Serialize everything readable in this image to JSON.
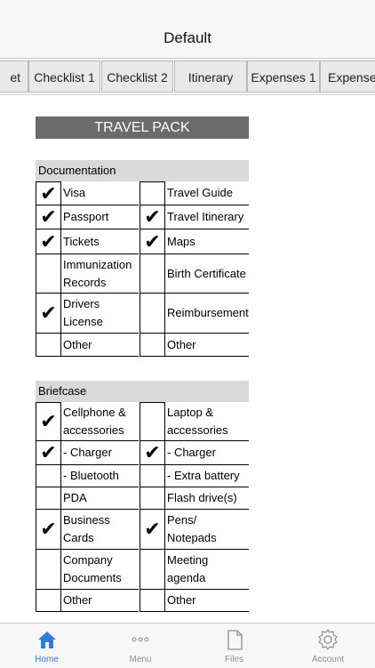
{
  "nav": {
    "title": "Default"
  },
  "tabs": [
    {
      "label": "et"
    },
    {
      "label": "Checklist 1"
    },
    {
      "label": "Checklist 2"
    },
    {
      "label": "Itinerary"
    },
    {
      "label": "Expenses 1"
    },
    {
      "label": "Expense"
    }
  ],
  "pack_title": "TRAVEL PACK",
  "sections": [
    {
      "title": "Documentation",
      "rows": [
        {
          "left": {
            "label": "Visa",
            "checked": true
          },
          "right": {
            "label": "Travel Guide",
            "checked": false
          }
        },
        {
          "left": {
            "label": "Passport",
            "checked": true
          },
          "right": {
            "label": "Travel Itinerary",
            "checked": true
          }
        },
        {
          "left": {
            "label": "Tickets",
            "checked": true
          },
          "right": {
            "label": "Maps",
            "checked": true
          }
        },
        {
          "left": {
            "label": "Immunization Records",
            "checked": false
          },
          "right": {
            "label": "Birth Certificate",
            "checked": false
          }
        },
        {
          "left": {
            "label": "Drivers License",
            "checked": true
          },
          "right": {
            "label": "Reimbursement",
            "checked": false
          }
        },
        {
          "left": {
            "label": "Other",
            "checked": false
          },
          "right": {
            "label": "Other",
            "checked": false
          }
        }
      ]
    },
    {
      "title": "Briefcase",
      "rows": [
        {
          "left": {
            "label": "Cellphone & accessories",
            "checked": true
          },
          "right": {
            "label": "Laptop & accessories",
            "checked": false
          }
        },
        {
          "left": {
            "label": "- Charger",
            "checked": true
          },
          "right": {
            "label": "- Charger",
            "checked": true
          }
        },
        {
          "left": {
            "label": "- Bluetooth",
            "checked": false
          },
          "right": {
            "label": "- Extra battery",
            "checked": false
          }
        },
        {
          "left": {
            "label": "PDA",
            "checked": false
          },
          "right": {
            "label": "Flash drive(s)",
            "checked": false
          }
        },
        {
          "left": {
            "label": "Business Cards",
            "checked": true
          },
          "right": {
            "label": "Pens/ Notepads",
            "checked": true
          }
        },
        {
          "left": {
            "label": "Company Documents",
            "checked": false
          },
          "right": {
            "label": "Meeting agenda",
            "checked": false
          }
        },
        {
          "left": {
            "label": "Other",
            "checked": false
          },
          "right": {
            "label": "Other",
            "checked": false
          }
        }
      ]
    }
  ],
  "tabbar": [
    {
      "label": "Home",
      "icon": "home-icon",
      "active": true
    },
    {
      "label": "Menu",
      "icon": "more-icon",
      "active": false
    },
    {
      "label": "Files",
      "icon": "document-icon",
      "active": false
    },
    {
      "label": "Account",
      "icon": "gear-icon",
      "active": false
    }
  ],
  "colors": {
    "accent": "#2f7ce0",
    "header_bar": "#6b6b6b",
    "section_bg": "#d9d9d9"
  }
}
